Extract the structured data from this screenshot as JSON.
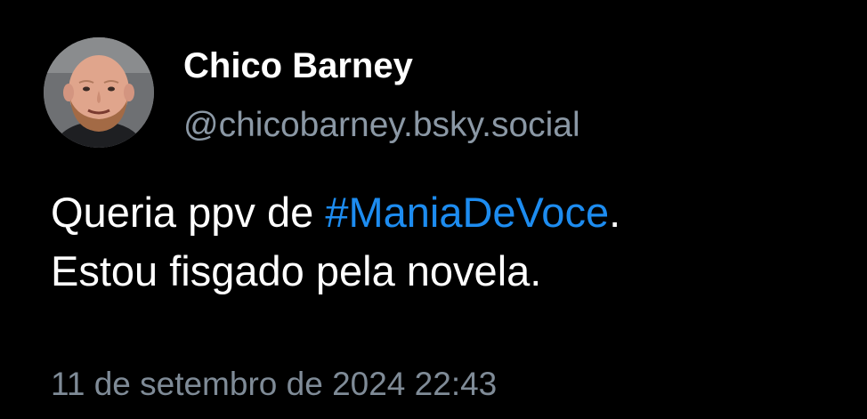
{
  "author": {
    "display_name": "Chico Barney",
    "handle": "@chicobarney.bsky.social",
    "avatar_icon": "user-photo"
  },
  "post": {
    "text_before_hashtag": "Queria ppv de ",
    "hashtag": "#ManiaDeVoce",
    "text_after_hashtag": ".",
    "line2": "Estou fisgado pela novela.",
    "timestamp": "11 de setembro de 2024 22:43"
  },
  "colors": {
    "background": "#000000",
    "text": "#ffffff",
    "secondary": "#8b98a5",
    "link": "#1d8cf0"
  }
}
